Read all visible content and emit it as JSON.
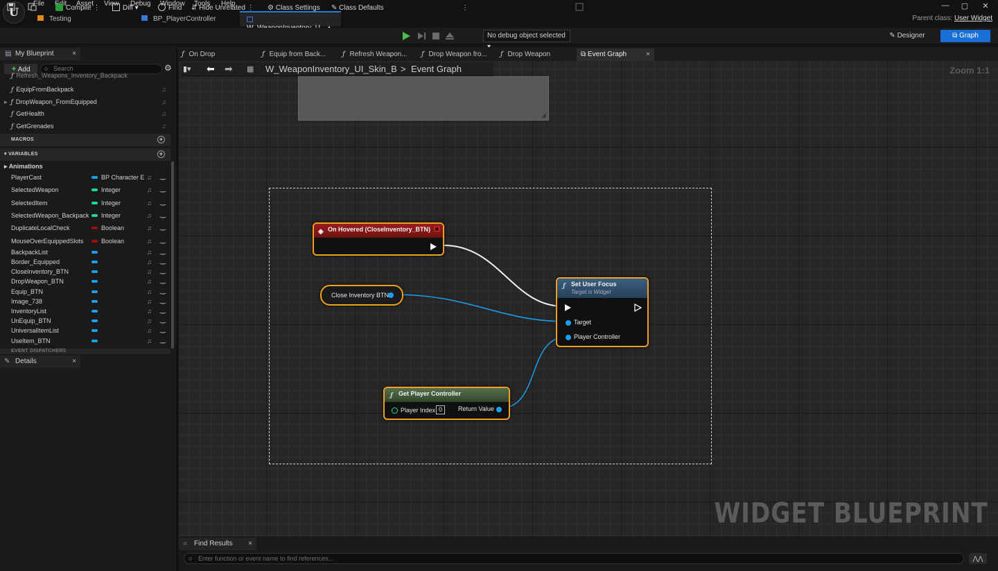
{
  "app": {
    "logo": "U"
  },
  "menu": [
    "File",
    "Edit",
    "Asset",
    "View",
    "Debug",
    "Window",
    "Tools",
    "Help"
  ],
  "doc_tabs": [
    {
      "label": "Testing",
      "close": ""
    },
    {
      "label": "BP_PlayerController",
      "close": ""
    },
    {
      "label": "W_WeaponInventory_U...",
      "close": "• ×"
    }
  ],
  "parent_class": {
    "label": "Parent class:",
    "value": "User Widget"
  },
  "window_controls": [
    "—",
    "▢",
    "✕"
  ],
  "toolbar": {
    "compile": "Compile",
    "diff": "Diff ▾",
    "find": "Find",
    "hide_unrelated": "Hide Unrelated",
    "class_settings": "Class Settings",
    "class_defaults": "Class Defaults",
    "debug_object": "No debug object selected ▾",
    "designer": "Designer",
    "graph": "Graph"
  },
  "my_blueprint": {
    "tab": "My Blueprint",
    "add": "Add",
    "search_placeholder": "Search",
    "functions": [
      "Refresh_Weapons_Inventory_Backpack",
      "EquipFromBackpack",
      "DropWeapon_FromEquipped",
      "GetHealth",
      "GetGrenades"
    ],
    "macros_label": "MACROS",
    "variables_label": "VARIABLES",
    "animations_label": "Animations",
    "variables": [
      {
        "name": "PlayerCast",
        "type": "BP Character E",
        "color": "#1a9ff0"
      },
      {
        "name": "SelectedWeapon",
        "type": "Integer",
        "color": "#1fd6a0"
      },
      {
        "name": "SelectedItem",
        "type": "Integer",
        "color": "#1fd6a0"
      },
      {
        "name": "SelectedWeapon_Backpack",
        "type": "Integer",
        "color": "#1fd6a0"
      },
      {
        "name": "DuplicateLocalCheck",
        "type": "Boolean",
        "color": "#a01010"
      },
      {
        "name": "MouseOverEquippedSlots",
        "type": "Boolean",
        "color": "#a01010"
      },
      {
        "name": "BackpackList",
        "type": "",
        "color": "#1a9ff0"
      },
      {
        "name": "Border_Equipped",
        "type": "",
        "color": "#1a9ff0"
      },
      {
        "name": "CloseInventory_BTN",
        "type": "",
        "color": "#1a9ff0"
      },
      {
        "name": "DropWeapon_BTN",
        "type": "",
        "color": "#1a9ff0"
      },
      {
        "name": "Equip_BTN",
        "type": "",
        "color": "#1a9ff0"
      },
      {
        "name": "Image_738",
        "type": "",
        "color": "#1a9ff0"
      },
      {
        "name": "InventoryList",
        "type": "",
        "color": "#1a9ff0"
      },
      {
        "name": "UnEquip_BTN",
        "type": "",
        "color": "#1a9ff0"
      },
      {
        "name": "UniversalItemList",
        "type": "",
        "color": "#1a9ff0"
      },
      {
        "name": "UseItem_BTN",
        "type": "",
        "color": "#1a9ff0"
      }
    ],
    "event_dispatchers_label": "EVENT DISPATCHERS"
  },
  "details": {
    "tab": "Details"
  },
  "graph_tabs": [
    "On Drop",
    "Equip from Back...",
    "Refresh Weapon...",
    "Drop Weapon fro...",
    "Drop Weapon",
    "Event Graph"
  ],
  "breadcrumb": {
    "blueprint": "W_WeaponInventory_UI_Skin_B",
    "graph": "Event Graph"
  },
  "zoom": "Zoom 1:1",
  "watermark": "WIDGET BLUEPRINT",
  "nodes": {
    "on_hovered": {
      "title": "On Hovered (CloseInventory_BTN)"
    },
    "close_btn": {
      "label": "Close Inventory BTN"
    },
    "set_focus": {
      "title": "Set User Focus",
      "subtitle": "Target is Widget",
      "target": "Target",
      "player_controller": "Player Controller"
    },
    "get_pc": {
      "title": "Get Player Controller",
      "player_index": "Player Index",
      "index_value": "0",
      "return_value": "Return Value"
    }
  },
  "find_results": {
    "tab": "Find Results",
    "placeholder": "Enter function or event name to find references..."
  }
}
